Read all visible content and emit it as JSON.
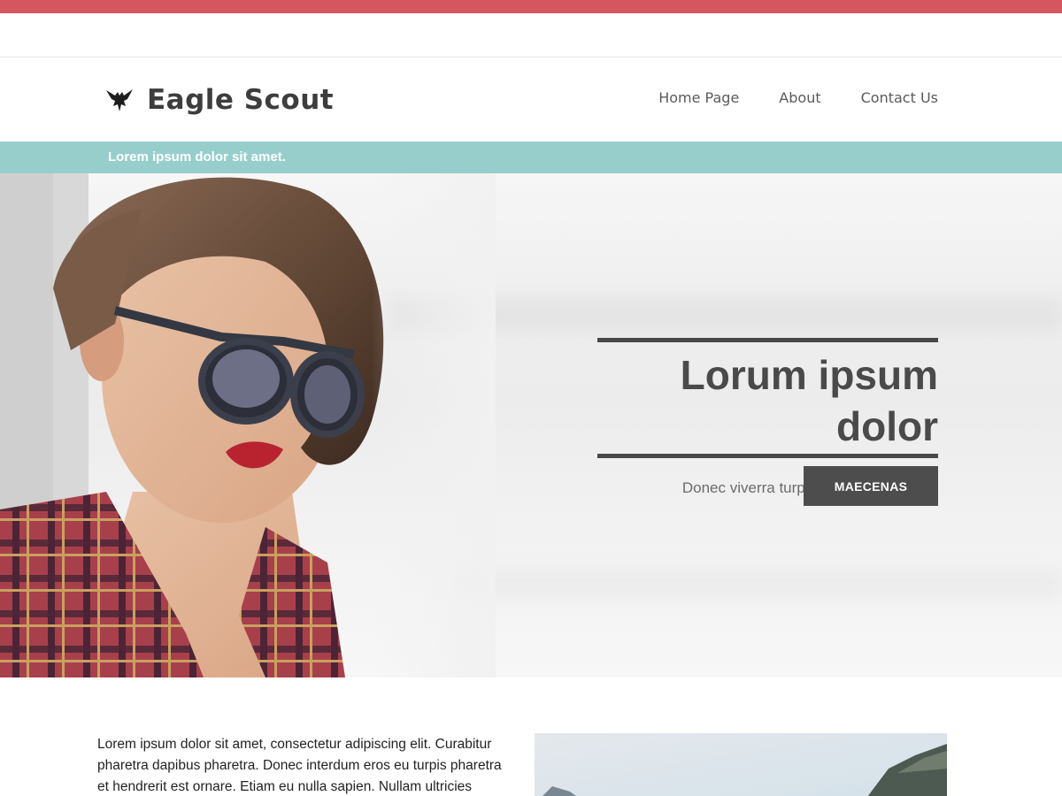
{
  "header": {
    "brand_name": "Eagle Scout",
    "brand_icon": "eagle-icon",
    "nav": [
      {
        "label": "Home Page"
      },
      {
        "label": "About"
      },
      {
        "label": "Contact Us"
      }
    ]
  },
  "ticker": {
    "text": "Lorem ipsum dolor sit amet."
  },
  "hero": {
    "title": "Lorum ipsum dolor",
    "subtitle": "Donec viverra turpis eu risus vulputate",
    "button_label": "MAECENAS"
  },
  "content": {
    "paragraph": "Lorem ipsum dolor sit amet, consectetur adipiscing elit. Curabitur pharetra dapibus pharetra. Donec interdum eros eu turpis pharetra et hendrerit est ornare. Etiam eu nulla sapien. Nullam ultricies"
  },
  "colors": {
    "top_bar": "#d5565e",
    "ticker": "#97cecc",
    "button": "#4d4d4d",
    "title": "#4a4a4a"
  }
}
